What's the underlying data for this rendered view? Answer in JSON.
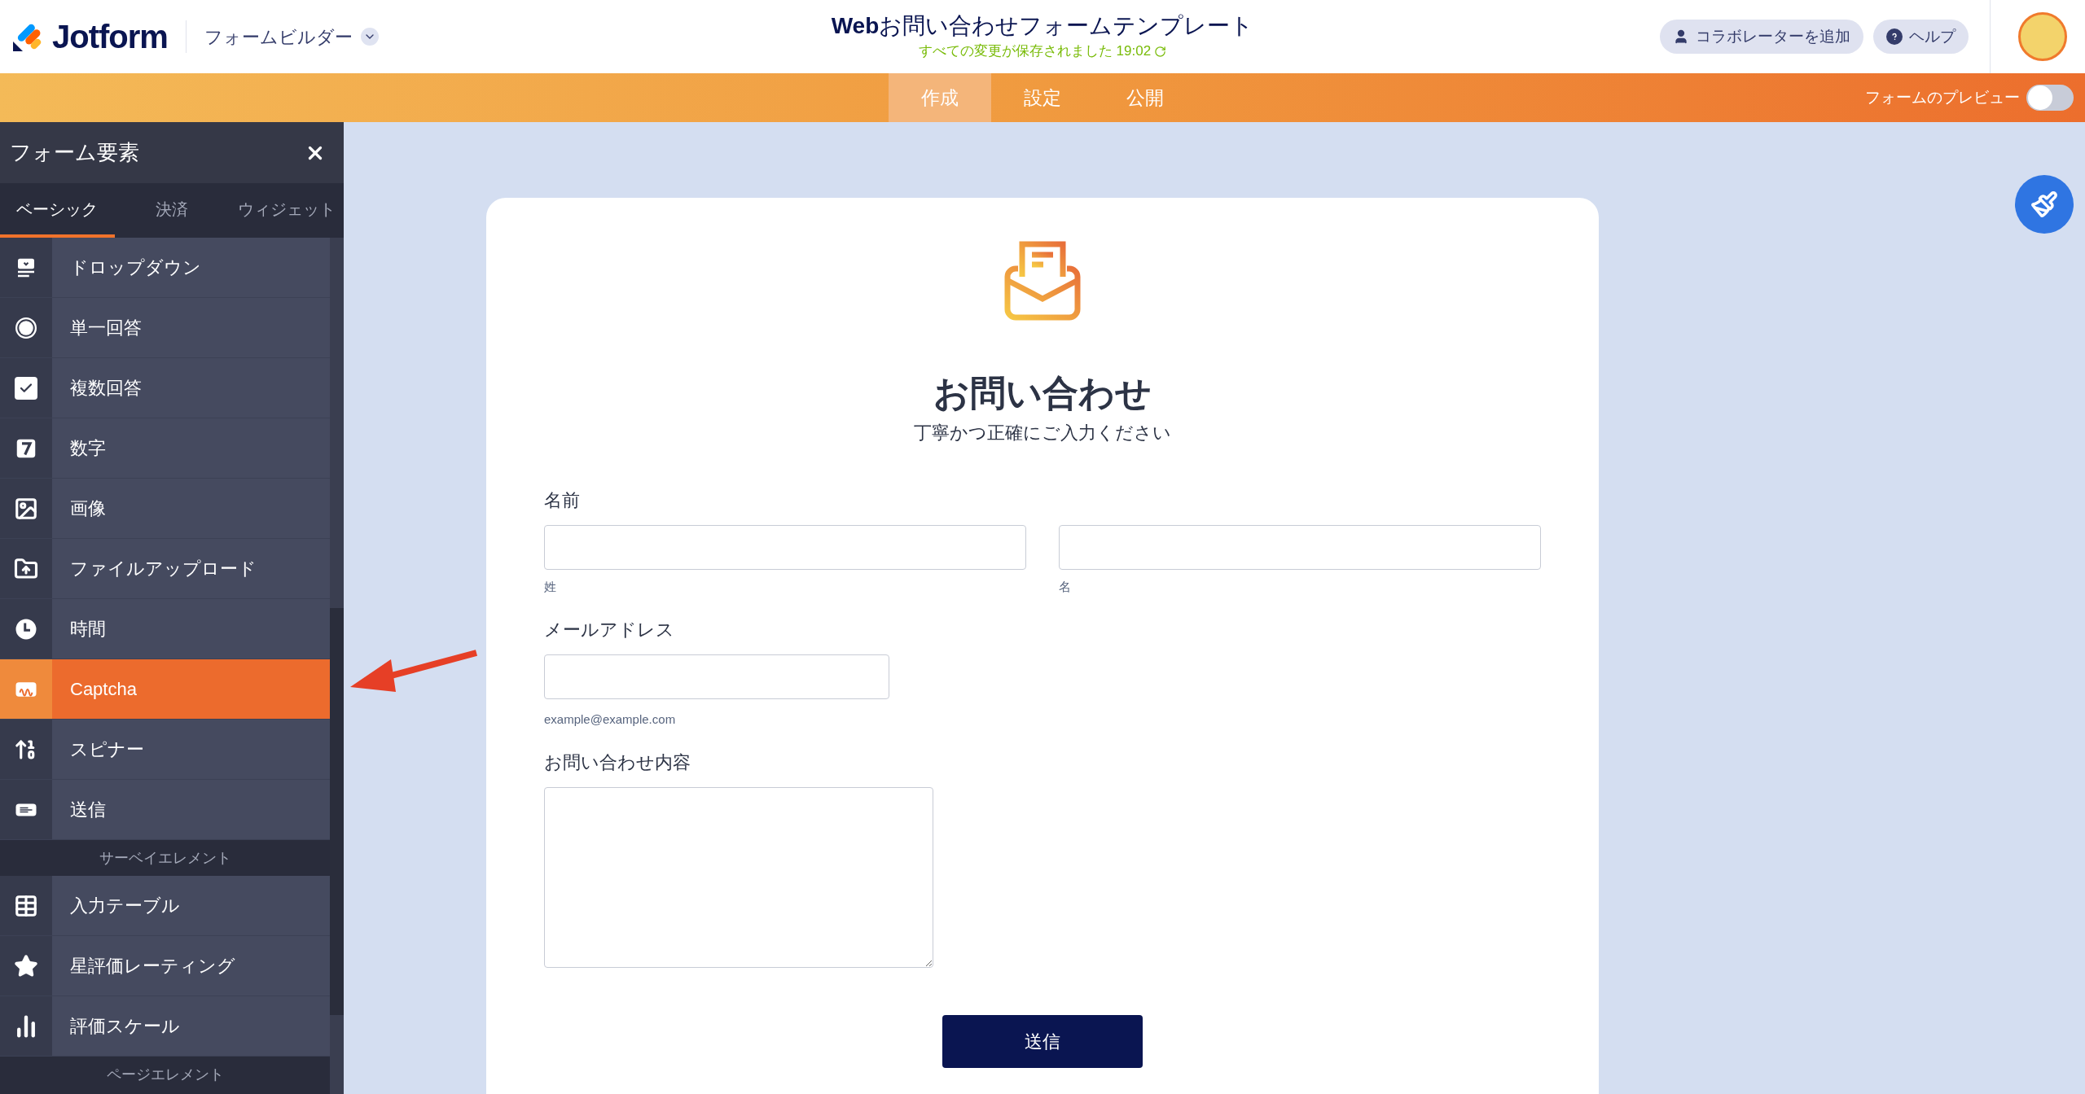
{
  "header": {
    "logo_text": "Jotform",
    "builder_menu": "フォームビルダー",
    "title": "**Web**お問い合わせフォームテンプレート",
    "save_status": "すべての変更が保存されました 19:02",
    "buttons": [
      {
        "kind": "collaborator",
        "label": "コラボレーターを追加"
      },
      {
        "kind": "help",
        "label": "ヘルプ"
      }
    ]
  },
  "nav": {
    "tabs": [
      {
        "label": "作成",
        "selected": true
      },
      {
        "label": "設定",
        "selected": false
      },
      {
        "label": "公開",
        "selected": false
      }
    ],
    "preview": {
      "label": "フォームのプレビュー",
      "on": false
    }
  },
  "sidebar": {
    "title": "フォーム要素",
    "tabs": [
      {
        "label": "ベーシック",
        "selected": true
      },
      {
        "label": "決済",
        "selected": false
      },
      {
        "label": "ウィジェット",
        "selected": false
      }
    ],
    "entries": [
      {
        "kind": "element",
        "label": "ドロップダウン",
        "selected": false
      },
      {
        "kind": "element",
        "label": "単一回答",
        "selected": false
      },
      {
        "kind": "element",
        "label": "複数回答",
        "selected": false
      },
      {
        "kind": "element",
        "label": "数字",
        "selected": false
      },
      {
        "kind": "element",
        "label": "画像",
        "selected": false
      },
      {
        "kind": "element",
        "label": "ファイルアップロード",
        "selected": false
      },
      {
        "kind": "element",
        "label": "時間",
        "selected": false
      },
      {
        "kind": "element",
        "label": "Captcha",
        "selected": true
      },
      {
        "kind": "element",
        "label": "スピナー",
        "selected": false
      },
      {
        "kind": "element",
        "label": "送信",
        "selected": false
      },
      {
        "kind": "section",
        "label": "サーベイエレメント"
      },
      {
        "kind": "element",
        "label": "入力テーブル",
        "selected": false
      },
      {
        "kind": "element",
        "label": "星評価レーティング",
        "selected": false
      },
      {
        "kind": "element",
        "label": "評価スケール",
        "selected": false
      },
      {
        "kind": "section",
        "label": "ページエレメント"
      }
    ]
  },
  "form": {
    "title": "お問い合わせ",
    "subtitle": "丁寧かつ正確にご入力ください",
    "fields": [
      {
        "kind": "name",
        "label": "名前",
        "sublabels": [
          "姓",
          "名"
        ]
      },
      {
        "kind": "email",
        "label": "メールアドレス",
        "hint": "example@example.com"
      },
      {
        "kind": "textarea",
        "label": "お問い合わせ内容"
      }
    ],
    "submit": "送信"
  }
}
